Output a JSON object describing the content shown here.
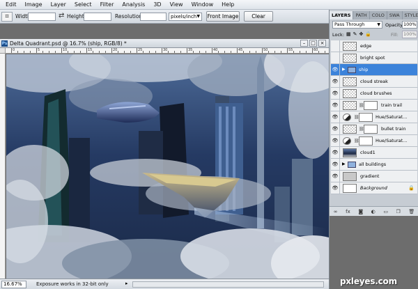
{
  "menubar": {
    "items": [
      "Edit",
      "Image",
      "Layer",
      "Select",
      "Filter",
      "Analysis",
      "3D",
      "View",
      "Window",
      "Help"
    ]
  },
  "options_bar": {
    "width_label": "Width:",
    "width_value": "",
    "height_label": "Height:",
    "height_value": "",
    "resolution_label": "Resolution:",
    "resolution_value": "",
    "resolution_unit": "pixels/inch",
    "front_image_label": "Front Image",
    "clear_label": "Clear"
  },
  "document": {
    "title": "Delta Quadrant.psd @ 16.7% (ship, RGB/8) *",
    "ps_badge": "Ps",
    "ruler_numbers": [
      "0",
      "5",
      "10",
      "15",
      "20",
      "25",
      "30",
      "35",
      "40",
      "45",
      "50",
      "55",
      "60"
    ]
  },
  "status": {
    "zoom": "16.67%",
    "message": "Exposure works in 32-bit only"
  },
  "layers_panel": {
    "tabs": [
      "LAYERS",
      "PATH",
      "COLO",
      "SWA",
      "STYLE"
    ],
    "blend_mode": "Pass Through",
    "opacity_label": "Opacity:",
    "opacity_value": "100%",
    "lock_label": "Lock:",
    "fill_label": "Fill:",
    "fill_value": "100%",
    "layers": [
      {
        "name": "edge",
        "visible": false,
        "kind": "normal"
      },
      {
        "name": "bright spot",
        "visible": false,
        "kind": "normal"
      },
      {
        "name": "ship",
        "visible": true,
        "kind": "group",
        "selected": true
      },
      {
        "name": "cloud streak",
        "visible": true,
        "kind": "normal"
      },
      {
        "name": "cloud brushes",
        "visible": true,
        "kind": "normal"
      },
      {
        "name": "train trail",
        "visible": true,
        "kind": "masked"
      },
      {
        "name": "Hue/Saturat...",
        "visible": true,
        "kind": "adjustment"
      },
      {
        "name": "bullet train",
        "visible": true,
        "kind": "masked"
      },
      {
        "name": "Hue/Saturat...",
        "visible": true,
        "kind": "adjustment"
      },
      {
        "name": "cloud1",
        "visible": true,
        "kind": "photo"
      },
      {
        "name": "all buildings",
        "visible": true,
        "kind": "folder"
      },
      {
        "name": "gradient",
        "visible": true,
        "kind": "grey"
      },
      {
        "name": "Background",
        "visible": true,
        "kind": "background"
      }
    ],
    "footer_icons": [
      "link-icon",
      "fx-icon",
      "mask-icon",
      "adjustment-icon",
      "folder-icon",
      "new-layer-icon",
      "trash-icon"
    ]
  },
  "watermark": "pxleyes.com",
  "colors": {
    "selection": "#3c83da",
    "panel_bg": "#c6ccd3",
    "workspace": "#6d6d6d"
  }
}
